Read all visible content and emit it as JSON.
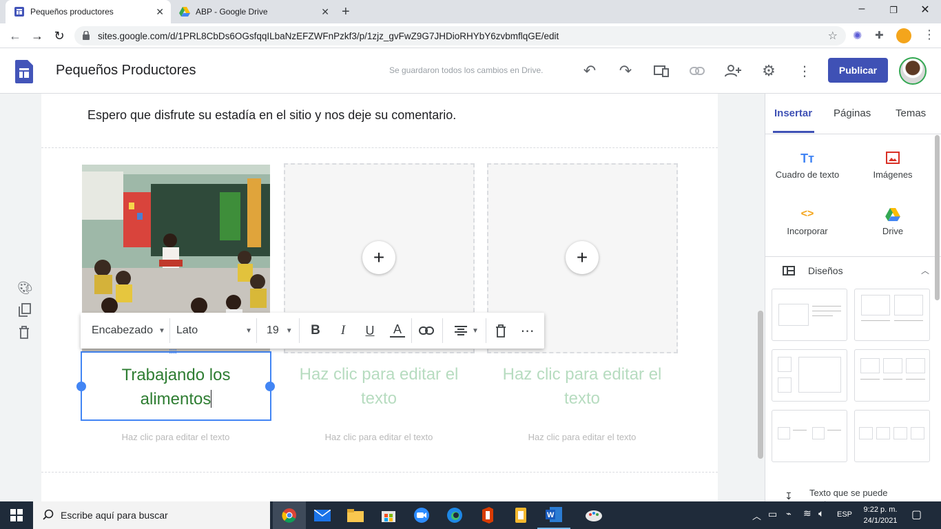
{
  "browser": {
    "tabs": [
      {
        "title": "Pequeños productores",
        "active": true
      },
      {
        "title": "ABP - Google Drive",
        "active": false
      }
    ],
    "url": "sites.google.com/d/1PRL8CbDs6OGsfqqILbaNzEFZWFnPzkf3/p/1zjz_gvFwZ9G7JHDioRHYbY6zvbmflqGE/edit"
  },
  "sites_header": {
    "site_title": "Pequeños Productores",
    "save_status": "Se guardaron todos los cambios en Drive.",
    "publish_label": "Publicar"
  },
  "page": {
    "intro_text": "Espero que disfrute su estadía en el sitio y nos deje su comentario.",
    "columns": [
      {
        "heading": "Trabajando los alimentos",
        "heading_line1": "Trabajando los",
        "heading_line2": "alimentos",
        "caption": "Haz clic para editar el texto",
        "has_image": true
      },
      {
        "heading_line1": "Haz clic para editar el",
        "heading_line2": "texto",
        "caption": "Haz clic para editar el texto",
        "has_image": false
      },
      {
        "heading_line1": "Haz clic para editar el",
        "heading_line2": "texto",
        "caption": "Haz clic para editar el texto",
        "has_image": false
      }
    ]
  },
  "toolbar": {
    "style": "Encabezado",
    "font": "Lato",
    "size": "19"
  },
  "right_panel": {
    "tabs": [
      "Insertar",
      "Páginas",
      "Temas"
    ],
    "active_tab": "Insertar",
    "insert_items": [
      {
        "label": "Cuadro de texto",
        "icon": "text-box-icon"
      },
      {
        "label": "Imágenes",
        "icon": "image-icon"
      },
      {
        "label": "Incorporar",
        "icon": "embed-icon"
      },
      {
        "label": "Drive",
        "icon": "drive-icon"
      }
    ],
    "layouts_label": "Diseños",
    "collapsible_text": "Texto que se puede contraer"
  },
  "taskbar": {
    "search_placeholder": "Escribe aquí para buscar",
    "language": "ESP",
    "time": "9:22 p. m.",
    "date": "24/1/2021"
  },
  "colors": {
    "accent": "#3f51b5",
    "heading_green": "#2e7d32",
    "placeholder_green": "#b7dcc0",
    "selection_blue": "#4285f4"
  }
}
